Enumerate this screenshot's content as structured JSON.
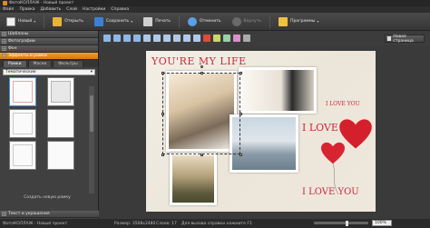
{
  "window": {
    "title": "ФотоКОЛЛАЖ - Новый проект"
  },
  "menu": [
    "Файл",
    "Правка",
    "Добавить",
    "Слой",
    "Настройки",
    "Справка"
  ],
  "toolbar": {
    "new_label": "Новый",
    "open_label": "Открыть",
    "save_label": "Сохранить",
    "print_label": "Печать",
    "undo_label": "Отменить",
    "redo_label": "Вернуть",
    "programs_label": "Программы"
  },
  "sidebar": {
    "sections": [
      {
        "label": "Шаблоны"
      },
      {
        "label": "Фотографии"
      },
      {
        "label": "Фон"
      },
      {
        "label": "Эффекты и рамки"
      }
    ],
    "subtabs": [
      "Рамки",
      "Маски",
      "Фильтры"
    ],
    "category_select": "Тематические",
    "create_label": "Создать новую рамку",
    "bottom_section": "Текст и украшения"
  },
  "edit_tools": {
    "new_page_label": "Новая страница"
  },
  "page": {
    "title_text": "YOU'RE MY LIFE",
    "love_small": "I LOVE YOU",
    "love_mid": "I LOVE",
    "love_bottom": "I LOVE YOU"
  },
  "status": {
    "size": "Размер:  3508x2480",
    "layers": "Слоев:  17",
    "hint": "Для вызова справки нажмите F1",
    "zoom": "100%"
  },
  "colors": {
    "accent": "#e89020",
    "love_red": "#c8283a"
  }
}
